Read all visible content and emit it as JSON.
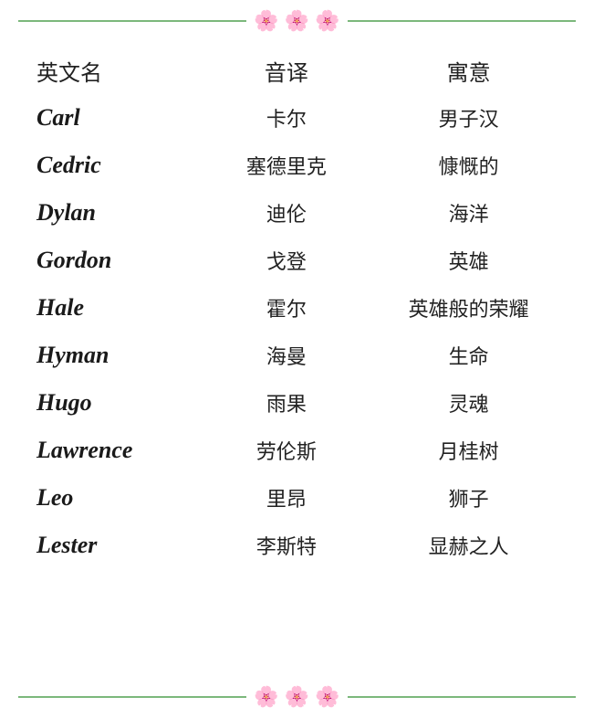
{
  "page": {
    "title": "英文名 音译 寓意",
    "headers": {
      "english": "英文名",
      "phonetic": "音译",
      "meaning": "寓意"
    },
    "rows": [
      {
        "english": "Carl",
        "phonetic": "卡尔",
        "meaning": "男子汉"
      },
      {
        "english": "Cedric",
        "phonetic": "塞德里克",
        "meaning": "慷慨的"
      },
      {
        "english": "Dylan",
        "phonetic": "迪伦",
        "meaning": "海洋"
      },
      {
        "english": "Gordon",
        "phonetic": "戈登",
        "meaning": "英雄"
      },
      {
        "english": "Hale",
        "phonetic": "霍尔",
        "meaning": "英雄般的荣耀"
      },
      {
        "english": "Hyman",
        "phonetic": "海曼",
        "meaning": "生命"
      },
      {
        "english": "Hugo",
        "phonetic": "雨果",
        "meaning": "灵魂"
      },
      {
        "english": "Lawrence",
        "phonetic": "劳伦斯",
        "meaning": "月桂树"
      },
      {
        "english": "Leo",
        "phonetic": "里昂",
        "meaning": "狮子"
      },
      {
        "english": "Lester",
        "phonetic": "李斯特",
        "meaning": "显赫之人"
      }
    ],
    "rose_emoji": "🌸",
    "divider_color": "#7cb87c"
  }
}
